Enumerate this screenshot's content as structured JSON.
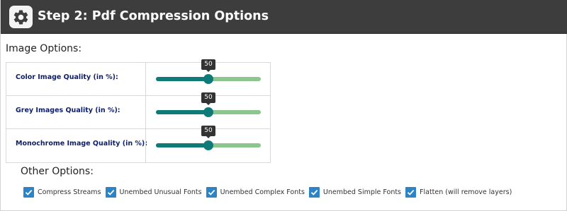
{
  "header": {
    "title": "Step 2: Pdf Compression Options",
    "icon": "gear-icon"
  },
  "image_options": {
    "label": "Image Options:",
    "rows": [
      {
        "label": "Color Image Quality (in %):",
        "value": 50,
        "min": 0,
        "max": 100
      },
      {
        "label": "Grey Images Quality (in %):",
        "value": 50,
        "min": 0,
        "max": 100
      },
      {
        "label": "Monochrome Image Quality (in %):",
        "value": 50,
        "min": 0,
        "max": 100
      }
    ]
  },
  "other_options": {
    "label": "Other Options:",
    "items": [
      {
        "label": "Compress Streams",
        "checked": true
      },
      {
        "label": "Unembed Unusual Fonts",
        "checked": true
      },
      {
        "label": "Unembed Complex Fonts",
        "checked": true
      },
      {
        "label": "Unembed Simple Fonts",
        "checked": true
      },
      {
        "label": "Flatten (will remove layers)",
        "checked": true
      }
    ]
  },
  "colors": {
    "header_background": "#3d3d3d",
    "row_label": "#0d1e6b",
    "slider_fill": "#0f7a78",
    "slider_track": "#8cc68c",
    "checkbox": "#2c84c6"
  }
}
